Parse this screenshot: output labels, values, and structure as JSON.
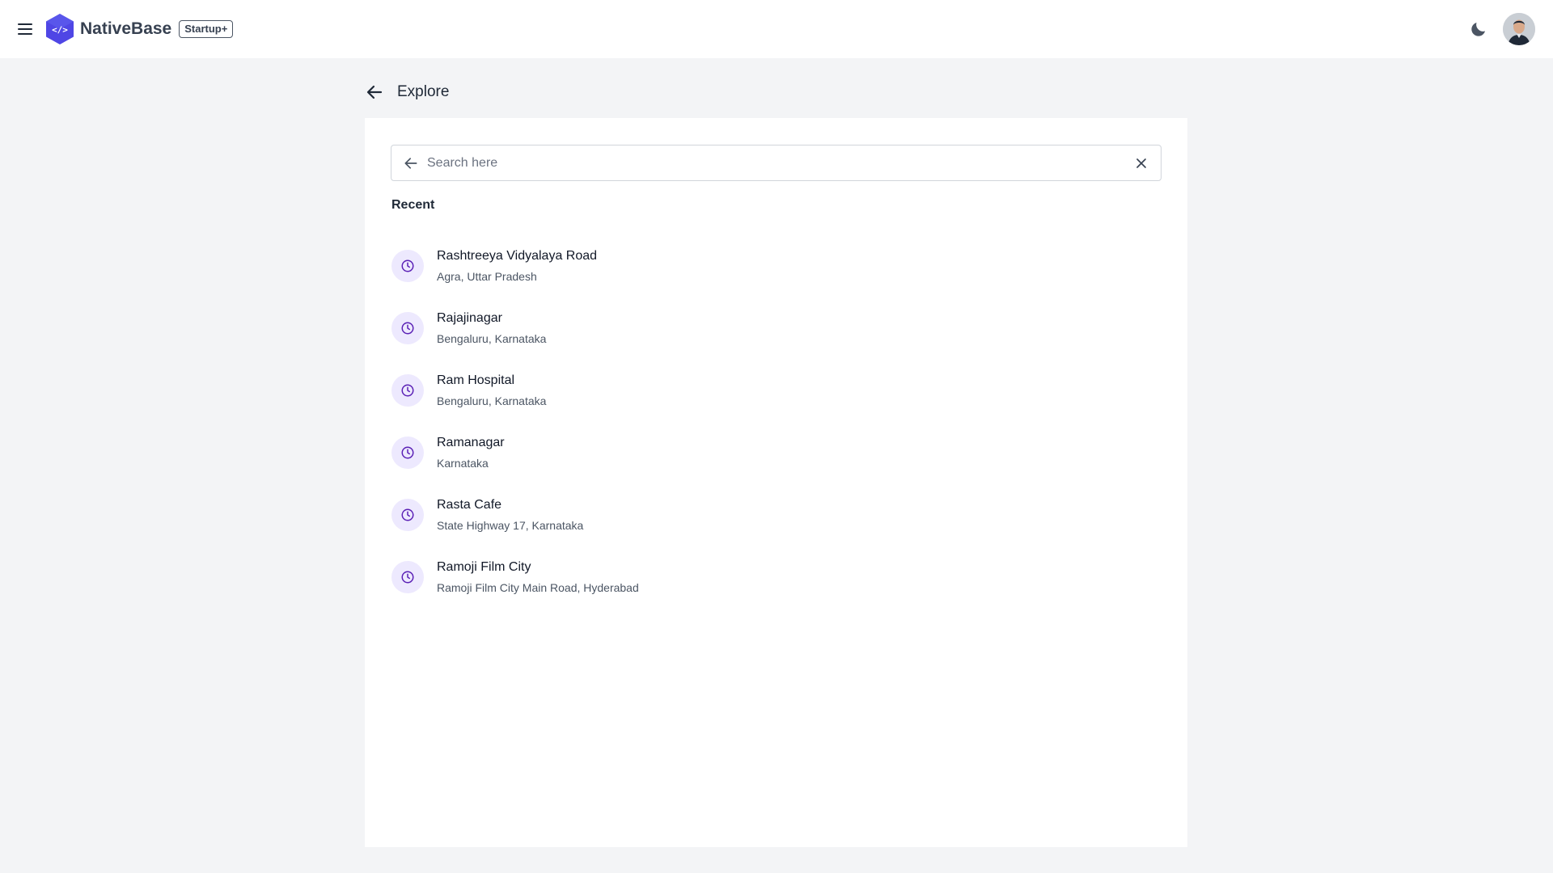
{
  "header": {
    "brand_name": "NativeBase",
    "badge": "Startup+",
    "icons": {
      "menu": "hamburger-menu-icon",
      "logo": "code-hexagon-logo-icon",
      "theme": "moon-icon"
    },
    "colors": {
      "logo": "#4f46e5",
      "accent": "#7c3aed"
    }
  },
  "page": {
    "title": "Explore"
  },
  "search": {
    "placeholder": "Search here",
    "value": ""
  },
  "recent": {
    "label": "Recent",
    "items": [
      {
        "title": "Rashtreeya Vidyalaya Road",
        "subtitle": "Agra, Uttar Pradesh"
      },
      {
        "title": "Rajajinagar",
        "subtitle": "Bengaluru, Karnataka"
      },
      {
        "title": "Ram Hospital",
        "subtitle": "Bengaluru, Karnataka"
      },
      {
        "title": "Ramanagar",
        "subtitle": "Karnataka"
      },
      {
        "title": "Rasta Cafe",
        "subtitle": "State Highway 17, Karnataka"
      },
      {
        "title": "Ramoji Film City",
        "subtitle": "Ramoji Film City Main Road, Hyderabad"
      }
    ]
  }
}
